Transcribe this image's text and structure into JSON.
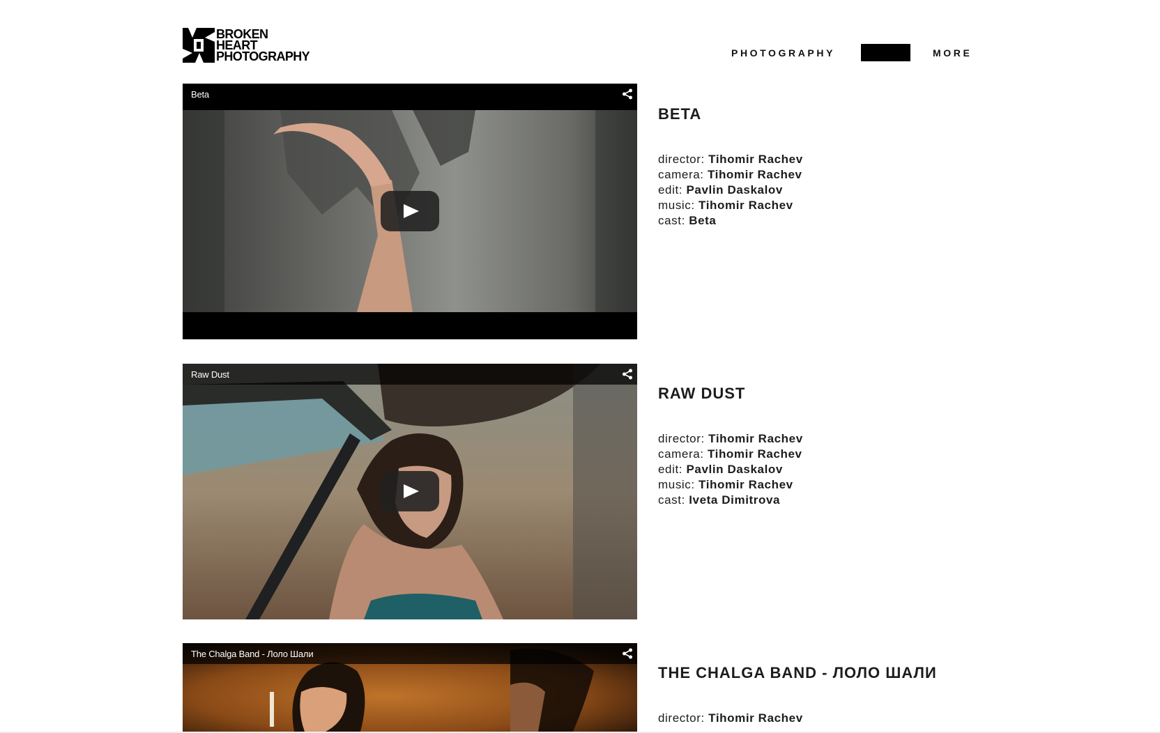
{
  "brand": {
    "lines": [
      "BROKEN",
      "HEART",
      "PHOTOGRAPHY"
    ]
  },
  "nav": {
    "photography": "PHOTOGRAPHY",
    "more": "MORE"
  },
  "videos": [
    {
      "player_title": "Beta",
      "heading": "BETA",
      "credits": [
        {
          "role": "director:",
          "name": "Tihomir Rachev"
        },
        {
          "role": "camera:",
          "name": "Tihomir Rachev"
        },
        {
          "role": "edit:",
          "name": "Pavlin Daskalov"
        },
        {
          "role": "music:",
          "name": "Tihomir Rachev"
        },
        {
          "role": "cast:",
          "name": "Beta"
        }
      ]
    },
    {
      "player_title": "Raw Dust",
      "heading": "RAW DUST",
      "credits": [
        {
          "role": "director:",
          "name": "Tihomir Rachev"
        },
        {
          "role": "camera:",
          "name": "Tihomir Rachev"
        },
        {
          "role": "edit:",
          "name": "Pavlin Daskalov"
        },
        {
          "role": "music:",
          "name": "Tihomir Rachev"
        },
        {
          "role": "cast:",
          "name": "Iveta Dimitrova"
        }
      ]
    },
    {
      "player_title": "The Chalga Band - Лоло Шали",
      "heading": "THE CHALGA BAND - ЛОЛО ШАЛИ",
      "credits": [
        {
          "role": "director:",
          "name": "Tihomir Rachev"
        }
      ]
    }
  ],
  "icons": {
    "play": "play-icon",
    "share": "share-icon",
    "logo": "logo-mark-icon"
  }
}
